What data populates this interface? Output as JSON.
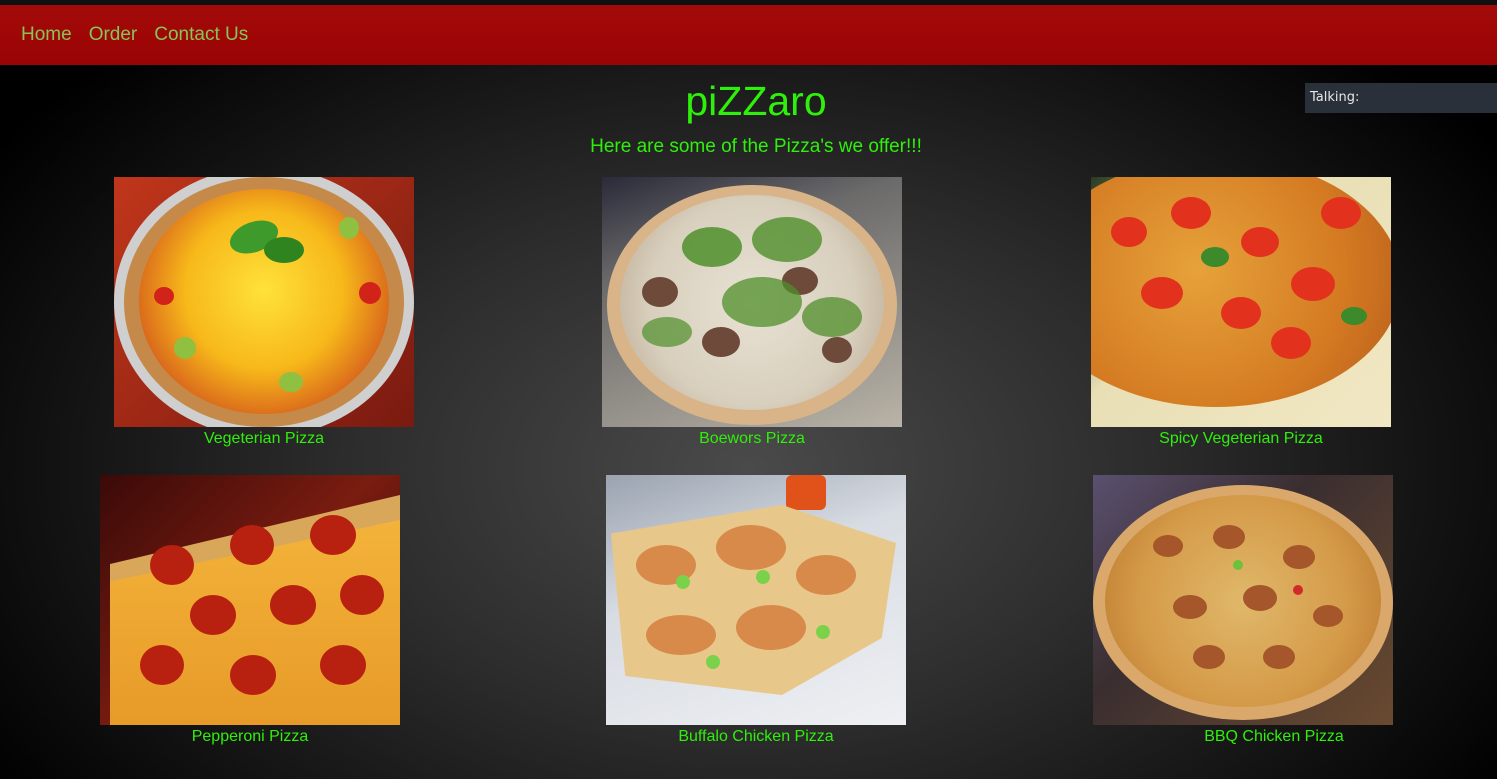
{
  "nav": {
    "items": [
      {
        "label": "Home"
      },
      {
        "label": "Order"
      },
      {
        "label": "Contact Us"
      }
    ]
  },
  "header": {
    "title": "piZZaro",
    "subtitle": "Here are some of the Pizza's we offer!!!"
  },
  "talking_widget": {
    "label": "Talking:"
  },
  "pizzas": [
    {
      "name": "Vegeterian Pizza"
    },
    {
      "name": "Boewors Pizza"
    },
    {
      "name": "Spicy Vegeterian Pizza"
    },
    {
      "name": "Pepperoni Pizza"
    },
    {
      "name": "Buffalo Chicken Pizza"
    },
    {
      "name": "BBQ Chicken Pizza"
    }
  ],
  "colors": {
    "navbar": "#a40a0a",
    "nav_text": "#8ac25a",
    "accent_green": "#2ff00a",
    "widget_bg": "#2a303a"
  }
}
